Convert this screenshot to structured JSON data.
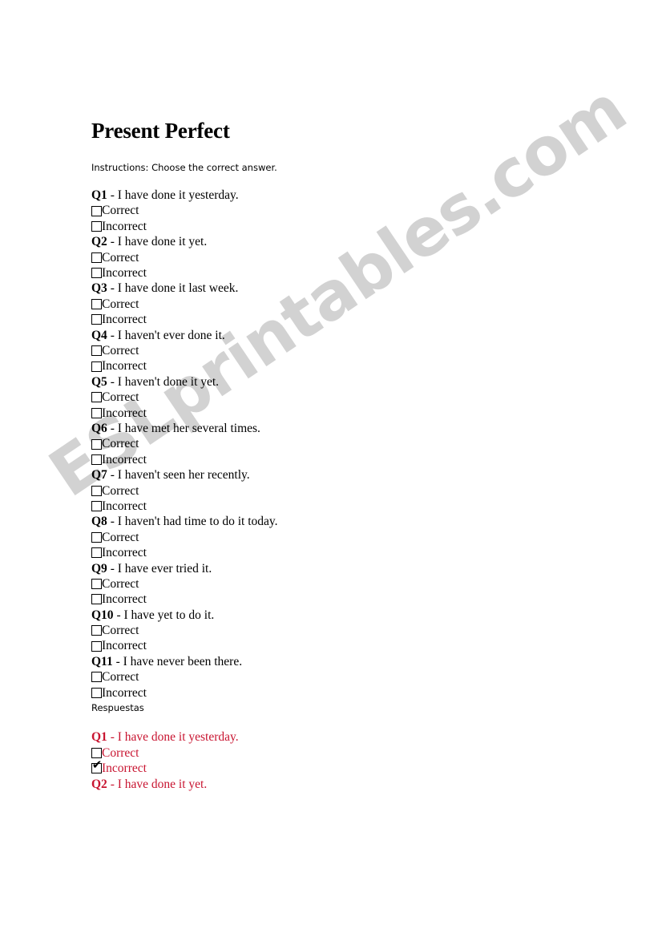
{
  "document": {
    "title": "Present Perfect",
    "instructions": "Instructions: Choose the correct answer.",
    "answers_heading": "Respuestas",
    "option_correct": "Correct",
    "option_incorrect": "Incorrect",
    "dash": " - ",
    "check_glyph": "✔",
    "answer_text_color": "#c81430",
    "text_color": "#000000",
    "watermark": "ESLprintables.com",
    "watermark_color": "#d2d2d2"
  },
  "questions": [
    {
      "label": "Q1",
      "text": "I have done it yesterday."
    },
    {
      "label": "Q2",
      "text": "I have done it yet."
    },
    {
      "label": "Q3",
      "text": "I have done it last week."
    },
    {
      "label": "Q4",
      "text": "I haven't ever done it."
    },
    {
      "label": "Q5",
      "text": "I haven't done it yet."
    },
    {
      "label": "Q6",
      "text": "I have met her several times."
    },
    {
      "label": "Q7",
      "text": "I haven't seen her recently."
    },
    {
      "label": "Q8",
      "text": "I haven't had time to do it today."
    },
    {
      "label": "Q9",
      "text": "I have ever tried it."
    },
    {
      "label": "Q10",
      "text": "I have yet to do it."
    },
    {
      "label": "Q11",
      "text": "I have never been there."
    }
  ],
  "answers": [
    {
      "label": "Q1",
      "text": "I have done it yesterday.",
      "correct_checked": false,
      "incorrect_checked": true
    },
    {
      "label": "Q2",
      "text": "I have done it yet.",
      "truncated": true
    }
  ]
}
